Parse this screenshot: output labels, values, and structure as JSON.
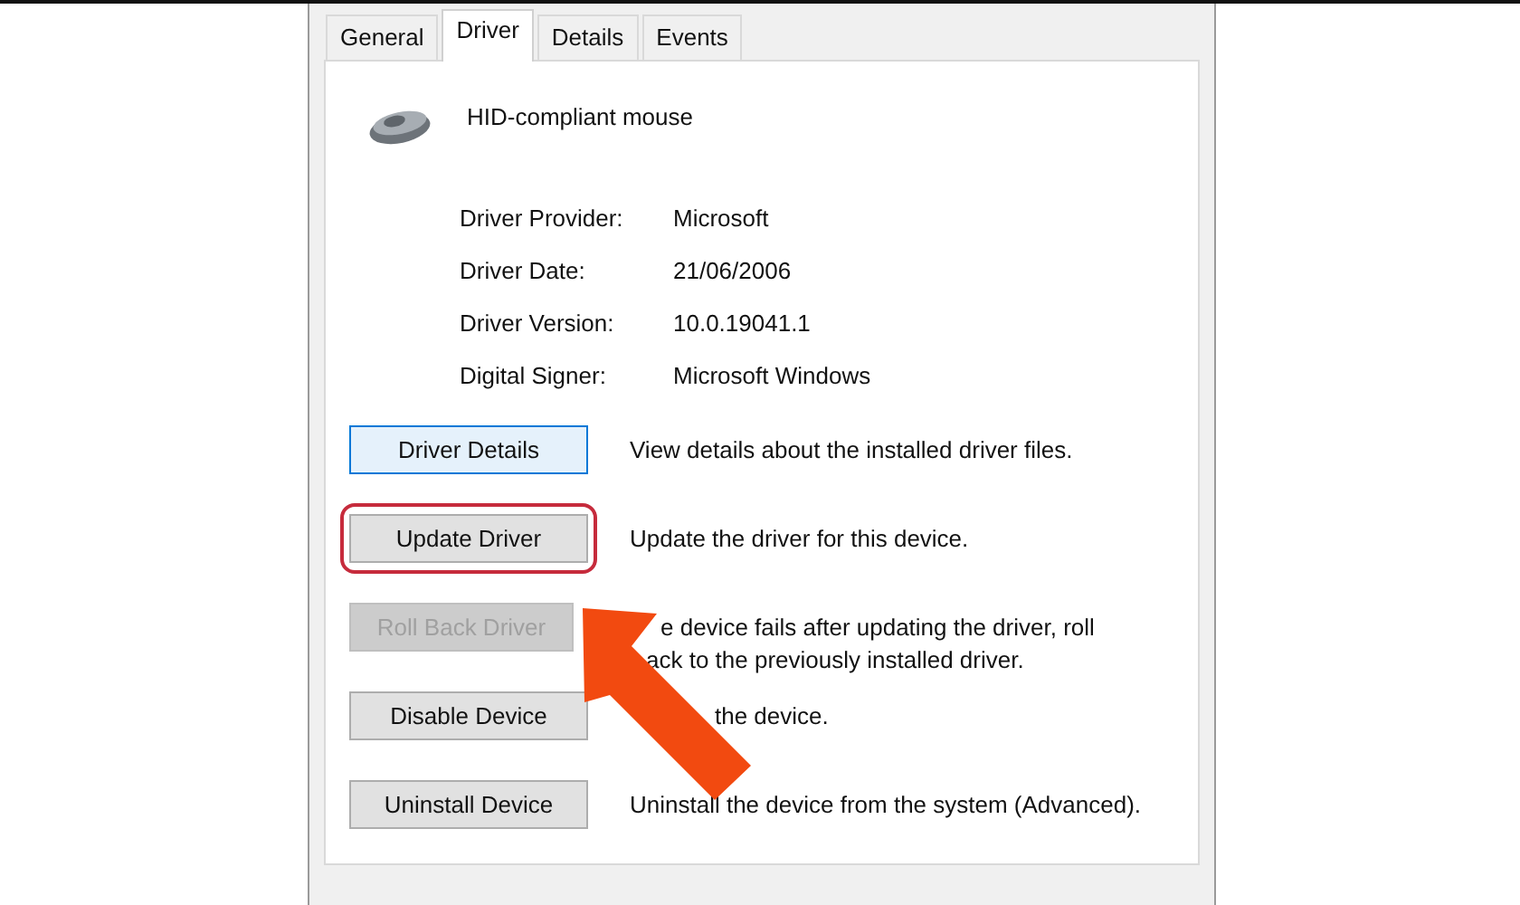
{
  "tabs": [
    {
      "label": "General",
      "selected": false
    },
    {
      "label": "Driver",
      "selected": true
    },
    {
      "label": "Details",
      "selected": false
    },
    {
      "label": "Events",
      "selected": false
    }
  ],
  "device": {
    "name": "HID-compliant mouse"
  },
  "properties": [
    {
      "label": "Driver Provider:",
      "value": "Microsoft"
    },
    {
      "label": "Driver Date:",
      "value": "21/06/2006"
    },
    {
      "label": "Driver Version:",
      "value": "10.0.19041.1"
    },
    {
      "label": "Digital Signer:",
      "value": "Microsoft Windows"
    }
  ],
  "actions": [
    {
      "button": "Driver Details",
      "disabled": false,
      "highlighted": false,
      "description": [
        "View details about the installed driver files."
      ]
    },
    {
      "button": "Update Driver",
      "disabled": false,
      "highlighted": true,
      "description": [
        "Update the driver for this device."
      ]
    },
    {
      "button": "Roll Back Driver",
      "disabled": true,
      "highlighted": false,
      "description": [
        "e device fails after updating the driver, roll",
        "ack to the previously installed driver."
      ]
    },
    {
      "button": "Disable Device",
      "disabled": false,
      "highlighted": false,
      "description": [
        "the device."
      ]
    },
    {
      "button": "Uninstall Device",
      "disabled": false,
      "highlighted": false,
      "description": [
        "Uninstall the device from the system (Advanced)."
      ]
    }
  ],
  "annotation": {
    "kind": "arrow"
  }
}
